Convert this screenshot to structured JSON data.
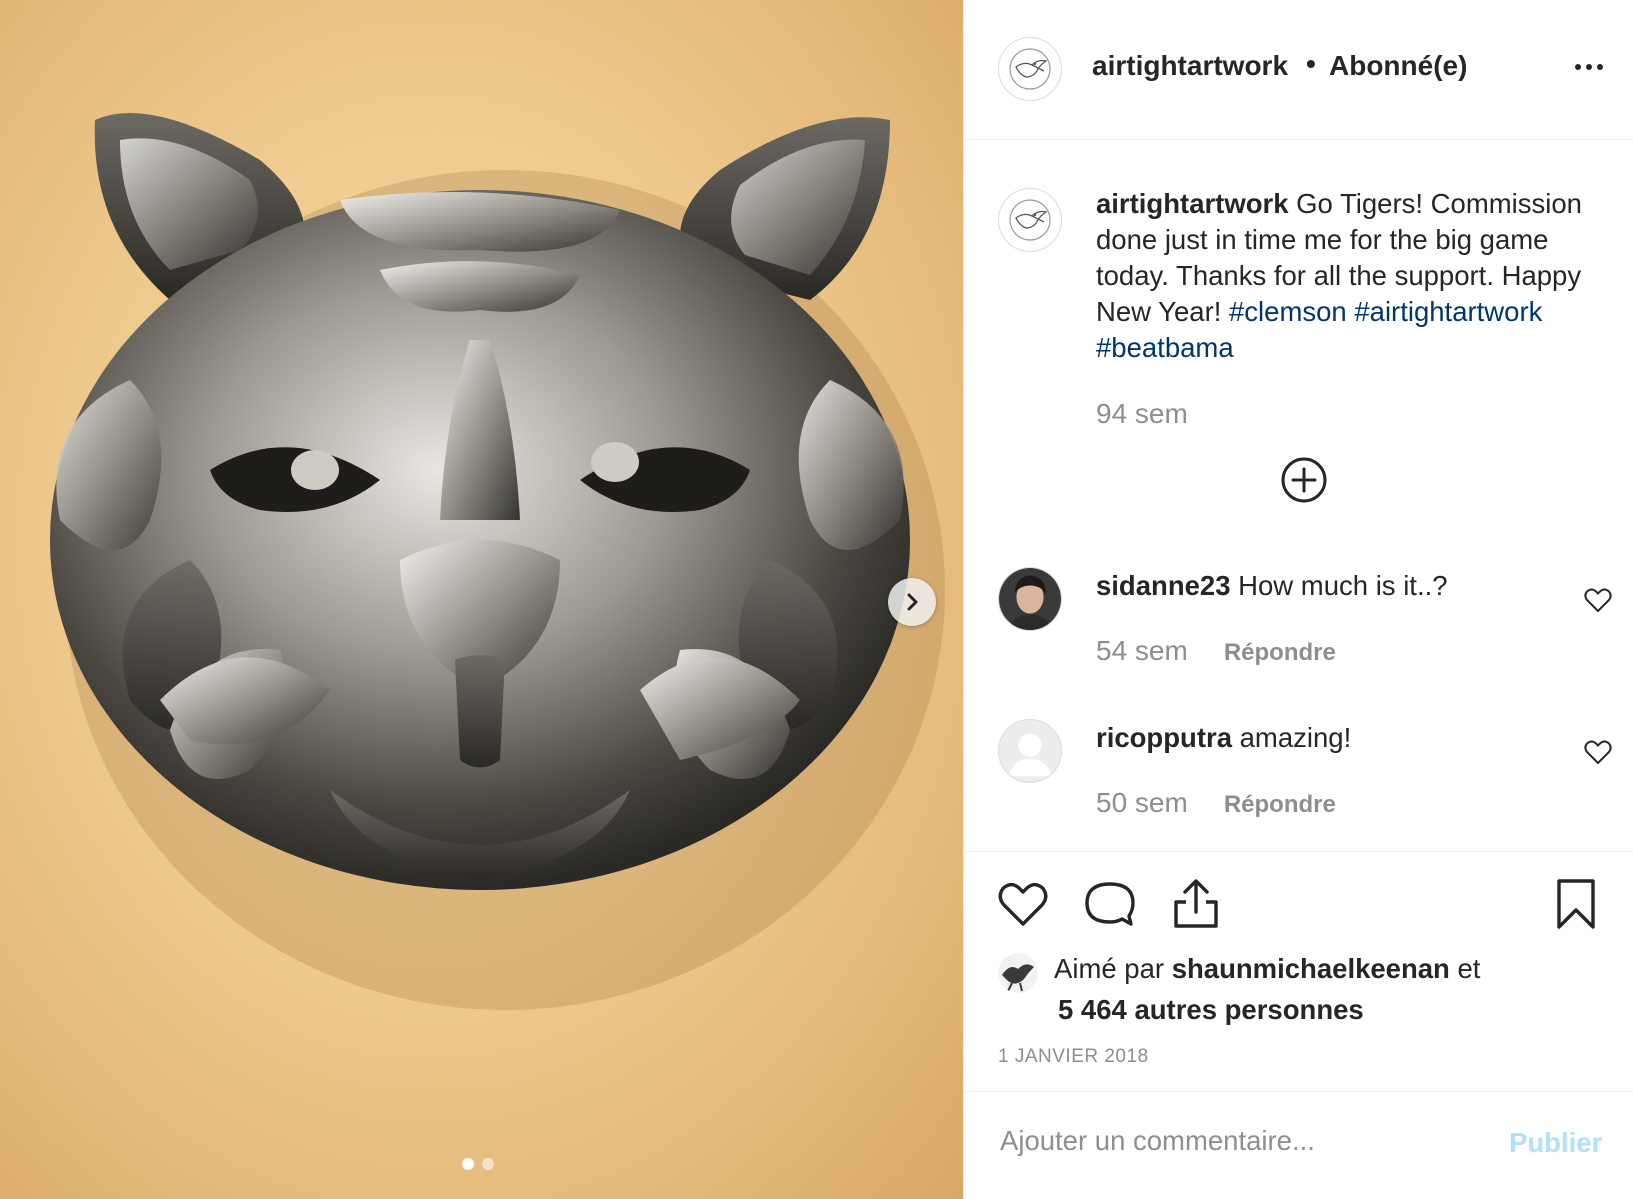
{
  "post": {
    "author": "airtightartwork",
    "separator": "•",
    "follow_status": "Abonné(e)",
    "more_icon": "more-horizontal-icon",
    "media": {
      "next_icon": "chevron-right-icon",
      "slides_count": 2,
      "active_slide": 1
    },
    "caption": {
      "username": "airtightartwork",
      "text": "Go Tigers! Commission done just in time me for the big game today. Thanks for all the support. Happy New Year!",
      "hashtags": [
        "#clemson",
        "#airtightartwork",
        "#beatbama"
      ],
      "time": "94 sem"
    },
    "load_more_icon": "plus-circle-icon",
    "comments": [
      {
        "username": "sidanne23",
        "text": "How much is it..?",
        "time": "54 sem",
        "reply_label": "Répondre"
      },
      {
        "username": "ricopputra",
        "text": "amazing!",
        "time": "50 sem",
        "reply_label": "Répondre"
      }
    ],
    "actions": {
      "like_icon": "heart-icon",
      "comment_icon": "comment-bubble-icon",
      "share_icon": "share-upload-icon",
      "save_icon": "bookmark-icon"
    },
    "likes": {
      "prefix": "Aimé par",
      "liker": "shaunmichaelkeenan",
      "conjunction": "et",
      "others": "5 464 autres personnes"
    },
    "date": "1 JANVIER 2018",
    "comment_box": {
      "placeholder": "Ajouter un commentaire...",
      "publish_label": "Publier"
    },
    "colors": {
      "hashtag": "#00376b",
      "muted": "#8e8e8e",
      "publish_disabled": "#b2dffc",
      "text": "#262626"
    }
  }
}
